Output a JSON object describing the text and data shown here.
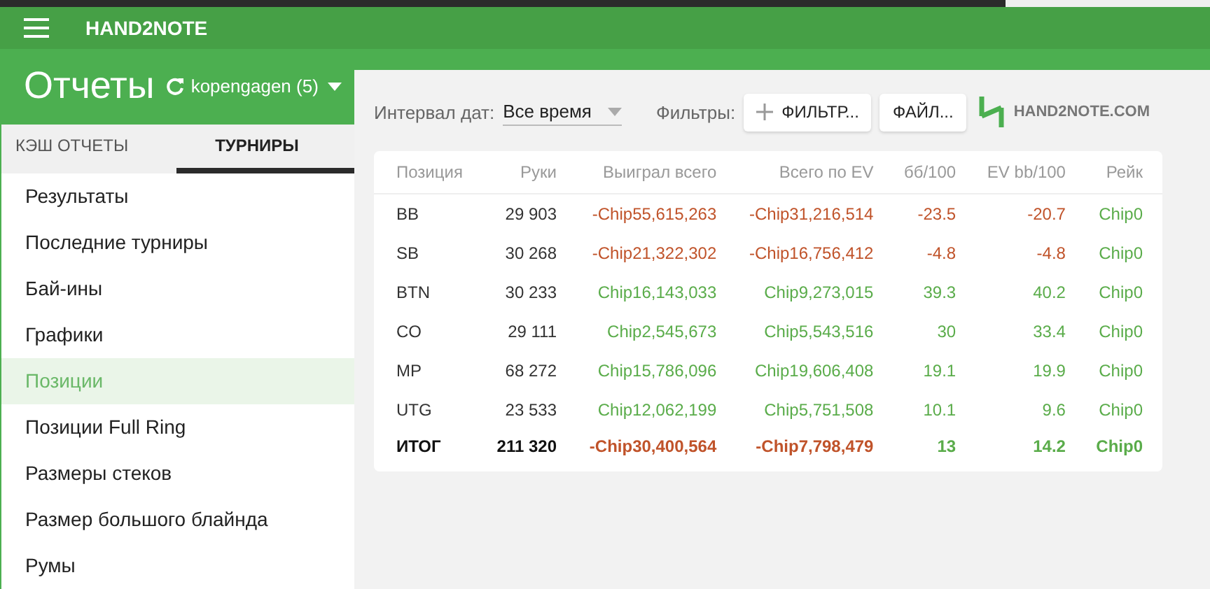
{
  "app_bar": {
    "title": "HAND2NOTE"
  },
  "header": {
    "title": "Отчеты",
    "account": "kopengagen (5)"
  },
  "tabs": [
    {
      "label": "КЭШ ОТЧЕТЫ",
      "selected": false
    },
    {
      "label": "ТУРНИРЫ",
      "selected": true
    }
  ],
  "sidebar": {
    "items": [
      {
        "label": "Результаты",
        "selected": false
      },
      {
        "label": "Последние турниры",
        "selected": false
      },
      {
        "label": "Бай-ины",
        "selected": false
      },
      {
        "label": "Графики",
        "selected": false
      },
      {
        "label": "Позиции",
        "selected": true
      },
      {
        "label": "Позиции Full Ring",
        "selected": false
      },
      {
        "label": "Размеры стеков",
        "selected": false
      },
      {
        "label": "Размер большого блайнда",
        "selected": false
      },
      {
        "label": "Румы",
        "selected": false
      }
    ]
  },
  "toolbar": {
    "interval_label": "Интервал дат:",
    "interval_value": "Все время",
    "filters_label": "Фильтры:",
    "filter_button": "ФИЛЬТР...",
    "file_button": "ФАЙЛ...",
    "logo": "HAND2NOTE.COM"
  },
  "table": {
    "columns": [
      "Позиция",
      "Руки",
      "Выиграл всего",
      "Всего по EV",
      "бб/100",
      "EV bb/100",
      "Рейк"
    ],
    "rows": [
      {
        "total": false,
        "position": "BB",
        "hands": "29 903",
        "values": [
          {
            "text": "-Chip55,615,263",
            "negative": true
          },
          {
            "text": "-Chip31,216,514",
            "negative": true
          },
          {
            "text": "-23.5",
            "negative": true
          },
          {
            "text": "-20.7",
            "negative": true
          },
          {
            "text": "Chip0",
            "negative": false
          }
        ]
      },
      {
        "total": false,
        "position": "SB",
        "hands": "30 268",
        "values": [
          {
            "text": "-Chip21,322,302",
            "negative": true
          },
          {
            "text": "-Chip16,756,412",
            "negative": true
          },
          {
            "text": "-4.8",
            "negative": true
          },
          {
            "text": "-4.8",
            "negative": true
          },
          {
            "text": "Chip0",
            "negative": false
          }
        ]
      },
      {
        "total": false,
        "position": "BTN",
        "hands": "30 233",
        "values": [
          {
            "text": "Chip16,143,033",
            "negative": false
          },
          {
            "text": "Chip9,273,015",
            "negative": false
          },
          {
            "text": "39.3",
            "negative": false
          },
          {
            "text": "40.2",
            "negative": false
          },
          {
            "text": "Chip0",
            "negative": false
          }
        ]
      },
      {
        "total": false,
        "position": "CO",
        "hands": "29 111",
        "values": [
          {
            "text": "Chip2,545,673",
            "negative": false
          },
          {
            "text": "Chip5,543,516",
            "negative": false
          },
          {
            "text": "30",
            "negative": false
          },
          {
            "text": "33.4",
            "negative": false
          },
          {
            "text": "Chip0",
            "negative": false
          }
        ]
      },
      {
        "total": false,
        "position": "MP",
        "hands": "68 272",
        "values": [
          {
            "text": "Chip15,786,096",
            "negative": false
          },
          {
            "text": "Chip19,606,408",
            "negative": false
          },
          {
            "text": "19.1",
            "negative": false
          },
          {
            "text": "19.9",
            "negative": false
          },
          {
            "text": "Chip0",
            "negative": false
          }
        ]
      },
      {
        "total": false,
        "position": "UTG",
        "hands": "23 533",
        "values": [
          {
            "text": "Chip12,062,199",
            "negative": false
          },
          {
            "text": "Chip5,751,508",
            "negative": false
          },
          {
            "text": "10.1",
            "negative": false
          },
          {
            "text": "9.6",
            "negative": false
          },
          {
            "text": "Chip0",
            "negative": false
          }
        ]
      },
      {
        "total": true,
        "position": "ИТОГ",
        "hands": "211 320",
        "values": [
          {
            "text": "-Chip30,400,564",
            "negative": true
          },
          {
            "text": "-Chip7,798,479",
            "negative": true
          },
          {
            "text": "13",
            "negative": false
          },
          {
            "text": "14.2",
            "negative": false
          },
          {
            "text": "Chip0",
            "negative": false
          }
        ]
      }
    ]
  }
}
